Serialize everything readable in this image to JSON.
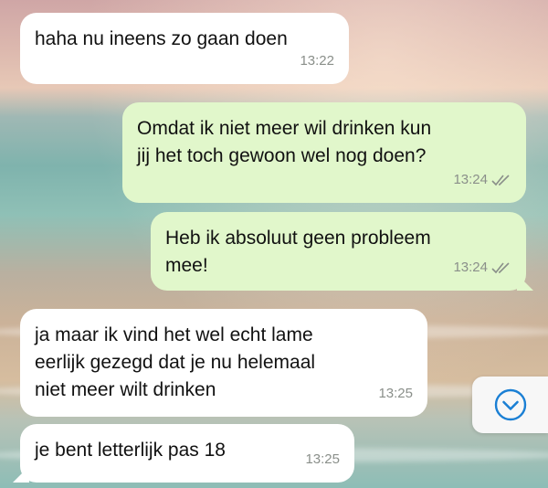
{
  "chat": {
    "messages": [
      {
        "direction": "incoming",
        "text": "haha nu ineens zo gaan doen",
        "time": "13:22"
      },
      {
        "direction": "outgoing",
        "text": "Omdat ik niet meer wil drinken kun\njij het toch gewoon wel nog doen?",
        "time": "13:24",
        "status": "read"
      },
      {
        "direction": "outgoing",
        "text": "Heb ik absoluut geen probleem\nmee!",
        "time": "13:24",
        "status": "read"
      },
      {
        "direction": "incoming",
        "text": "ja maar ik vind het wel echt lame\neerlijk gezegd dat je nu helemaal\nniet meer wilt drinken",
        "time": "13:25"
      },
      {
        "direction": "incoming",
        "text": "je bent letterlijk pas 18",
        "time": "13:25"
      }
    ],
    "scroll_down_icon": "chevron-down-circle-icon"
  },
  "colors": {
    "incoming_bubble": "#ffffff",
    "outgoing_bubble": "#e1f7cb",
    "timestamp": "#8a8f8a",
    "scroll_icon": "#1a7fd4"
  }
}
